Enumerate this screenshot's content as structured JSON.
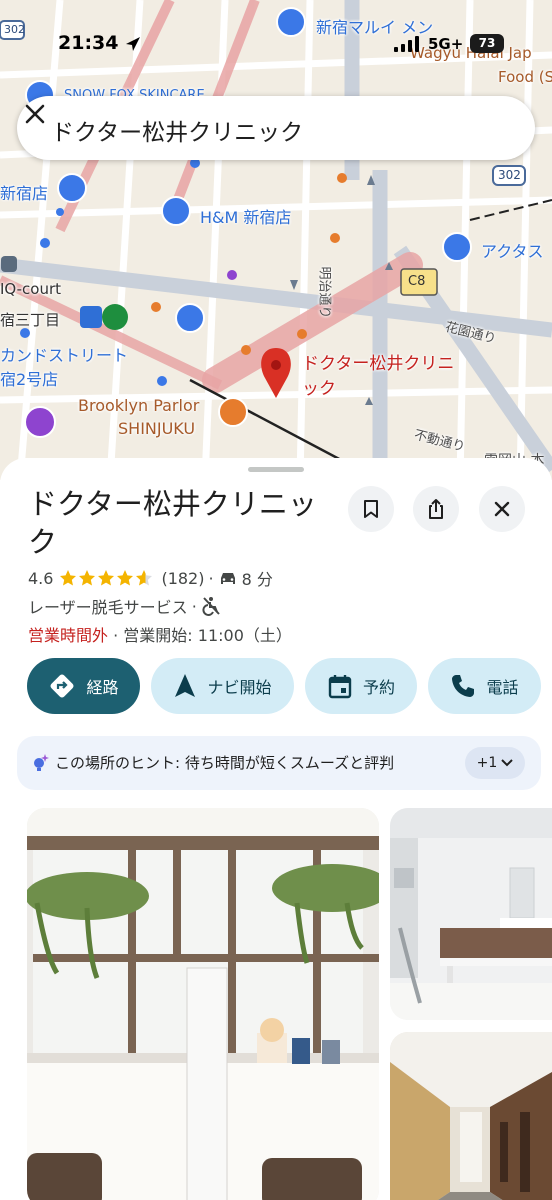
{
  "status_bar": {
    "time": "21:34",
    "network": "5G+",
    "battery": "73"
  },
  "search": {
    "query": "ドクター松井クリニック"
  },
  "map": {
    "labels": {
      "shinjuku_marui_men": "新宿マルイ メン",
      "wagyu_halal": "Wagyu Halal Jap",
      "food": "Food (S",
      "snow_fox": "SNOW FOX SKINCARE",
      "shinjuku_store": "新宿店",
      "hm": "H&M 新宿店",
      "actus": "アクタス",
      "iq_court": "IQ-court",
      "sanchome": "宿三丁目",
      "candy_street": "カンドストリート",
      "shop2": "宿2号店",
      "brooklyn1": "Brooklyn Parlor",
      "brooklyn2": "SHINJUKU",
      "clinic1": "ドクター松井クリニ",
      "clinic2": "ック",
      "kaendori": "花園通り",
      "fudodori": "不動通り",
      "meiji_dori": "明治通り",
      "route_302a": "302",
      "route_302b": "302",
      "c8": "C8",
      "cut_label": "雲岡山 本"
    }
  },
  "place": {
    "title": "ドクター松井クリニック",
    "rating": "4.6",
    "review_count": "(182)",
    "drive_time": "8 分",
    "category": "レーザー脱毛サービス",
    "status": "営業時間外",
    "opens": "営業開始: 11:00（土）"
  },
  "actions": {
    "directions": "経路",
    "navigate": "ナビ開始",
    "reserve": "予約",
    "call": "電話"
  },
  "hint": {
    "text": "この場所のヒント: 待ち時間が短くスムーズと評判",
    "more": "+1"
  },
  "colors": {
    "primary_action": "#1d6071",
    "secondary_action": "#d3ecf6",
    "closed_red": "#c5221f",
    "star": "#f4b400",
    "pin": "#d93025"
  }
}
